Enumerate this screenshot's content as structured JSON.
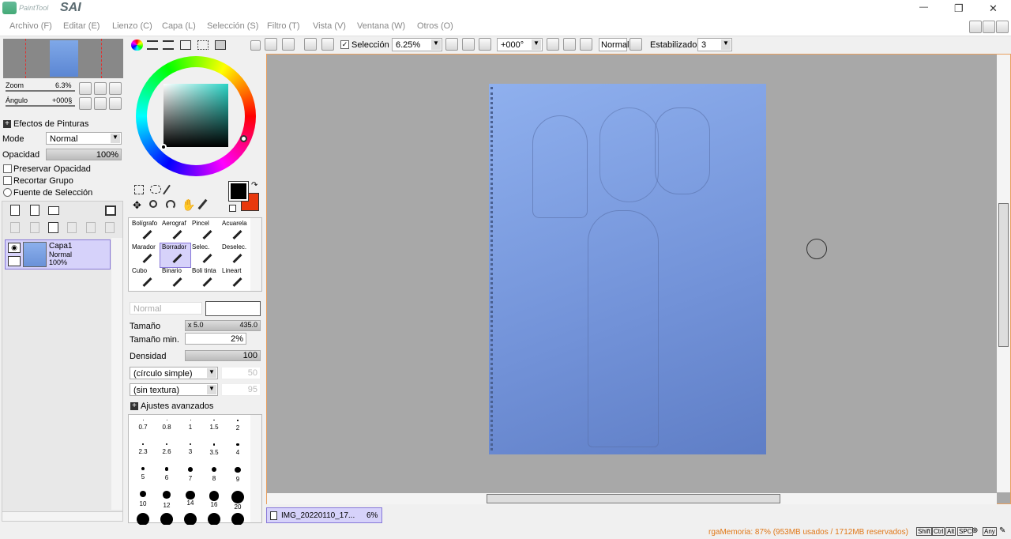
{
  "app": {
    "title": "PaintTool SAI",
    "logo_text": "PaintTool",
    "logo_big": "SAI"
  },
  "window_controls": {
    "minimize": "—",
    "restore": "❐",
    "close": "✕"
  },
  "menu": [
    "Archivo (F)",
    "Editar (E)",
    "Lienzo (C)",
    "Capa (L)",
    "Selección (S)",
    "Filtro (T)",
    "Vista (V)",
    "Ventana (W)",
    "Otros (O)"
  ],
  "toolbar": {
    "selection_label": "Selección",
    "zoom": "6.25%",
    "angle": "+000°",
    "blend": "Normal",
    "stabilizer_label": "Estabilizador",
    "stabilizer": "3"
  },
  "navigator": {
    "zoom_label": "Zoom",
    "zoom_value": "6.3%",
    "angle_label": "Ángulo",
    "angle_value": "+000§"
  },
  "layer_panel": {
    "effects_label": "Efectos de Pinturas",
    "mode_label": "Mode",
    "mode_value": "Normal",
    "opacity_label": "Opacidad",
    "opacity_value": "100%",
    "preserve_opacity": "Preservar Opacidad",
    "clip_group": "Recortar Grupo",
    "selection_source": "Fuente de Selección",
    "layer": {
      "name": "Capa1",
      "mode": "Normal",
      "opacity": "100%"
    }
  },
  "tools": [
    {
      "label": "Bolígrafo",
      "row": 0,
      "col": 0
    },
    {
      "label": "Aerograf",
      "row": 0,
      "col": 1
    },
    {
      "label": "Pincel",
      "row": 0,
      "col": 2
    },
    {
      "label": "Acuarela",
      "row": 0,
      "col": 3
    },
    {
      "label": "Marador",
      "row": 1,
      "col": 0
    },
    {
      "label": "Borrador",
      "row": 1,
      "col": 1
    },
    {
      "label": "Selec.",
      "row": 1,
      "col": 2
    },
    {
      "label": "Deselec.",
      "row": 1,
      "col": 3
    },
    {
      "label": "Cubo",
      "row": 2,
      "col": 0
    },
    {
      "label": "Binario",
      "row": 2,
      "col": 1
    },
    {
      "label": "Boli tinta",
      "row": 2,
      "col": 2
    },
    {
      "label": "Lineart",
      "row": 2,
      "col": 3
    }
  ],
  "brush": {
    "blend_value": "Normal",
    "size_label": "Tamaño",
    "size_mult": "x 5.0",
    "size_value": "435.0",
    "min_size_label": "Tamaño min.",
    "min_size_value": "2%",
    "density_label": "Densidad",
    "density_value": "100",
    "shape": "(círculo simple)",
    "shape_value": "50",
    "texture": "(sin textura)",
    "texture_value": "95",
    "advanced_label": "Ajustes avanzados"
  },
  "brush_sizes": [
    "0.7",
    "0.8",
    "1",
    "1.5",
    "2",
    "2.3",
    "2.6",
    "3",
    "3.5",
    "4",
    "5",
    "6",
    "7",
    "8",
    "9",
    "10",
    "12",
    "14",
    "16",
    "20"
  ],
  "document_tab": {
    "name": "IMG_20220110_17...",
    "zoom": "6%"
  },
  "status": {
    "memory": "rgaMemoria: 87% (953MB usados / 1712MB reservados)",
    "keys": [
      "Shift",
      "Ctrl",
      "Alt",
      "SPC",
      "Any"
    ]
  },
  "colors": {
    "primary": "#000000",
    "secondary": "#e8380d",
    "accent": "#b8b0f0",
    "canvas_paper": "#7f9fe0"
  }
}
